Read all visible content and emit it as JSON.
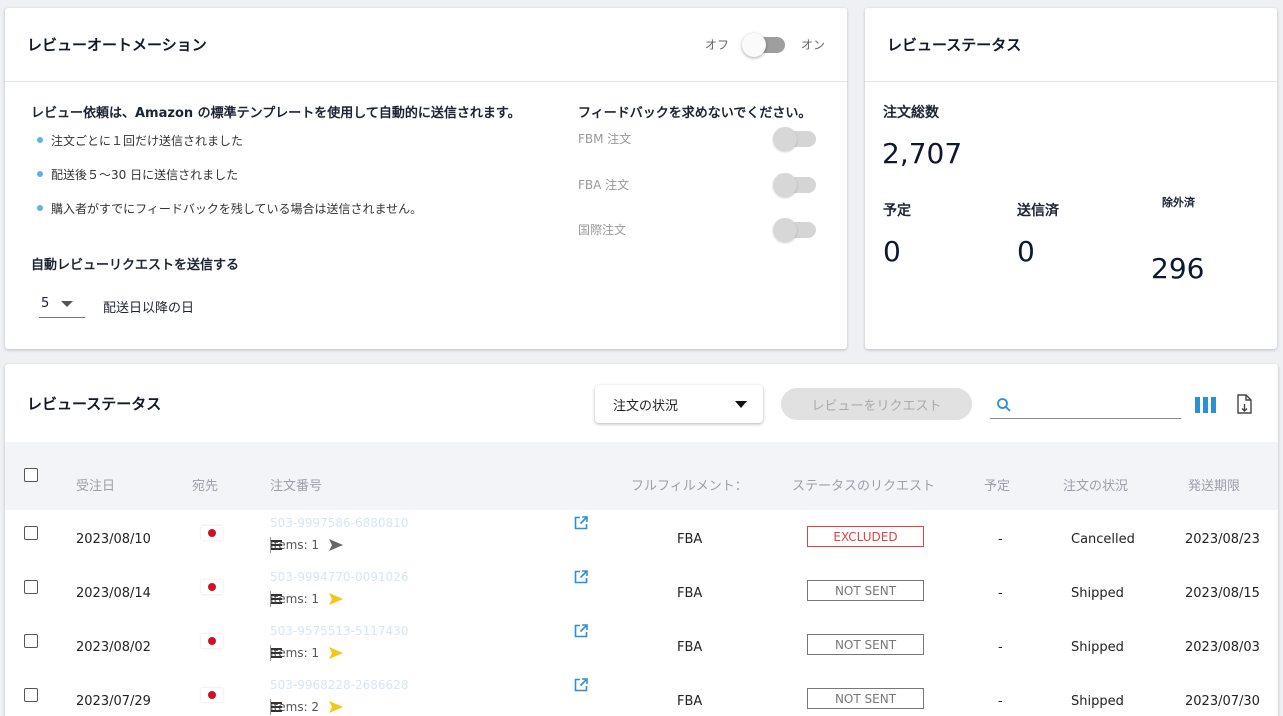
{
  "automation": {
    "title": "レビューオートメーション",
    "toggle_off": "オフ",
    "toggle_on": "オン",
    "request_desc": "レビュー依頼は、Amazon の標準テンプレートを使用して自動的に送信されます。",
    "bullets": [
      "注文ごとに１回だけ送信されました",
      "配送後５〜30 日に送信されました",
      "購入者がすでにフィードバックを残している場合は送信されません。"
    ],
    "send_title": "自動レビューリクエストを送信する",
    "days_value": "5",
    "days_suffix": "配送日以降の日",
    "feedback_title": "フィードバックを求めないでください。",
    "feedback_options": [
      "FBM 注文",
      "FBA 注文",
      "国際注文"
    ]
  },
  "status_card": {
    "title": "レビューステータス",
    "total_label": "注文総数",
    "total_value": "2,707",
    "scheduled_label": "予定",
    "scheduled_value": "0",
    "sent_label": "送信済",
    "sent_value": "0",
    "excluded_label": "除外済",
    "excluded_value": "296"
  },
  "table": {
    "title": "レビューステータス",
    "order_status_select": "注文の状況",
    "request_button": "レビューをリクエスト",
    "search_placeholder": "",
    "columns": [
      "受注日",
      "宛先",
      "注文番号",
      "フルフィルメント：",
      "ステータスのリクエスト",
      "予定",
      "注文の状況",
      "発送期限"
    ],
    "rows": [
      {
        "date": "2023/08/10",
        "order_no": "503-9997586-6880810",
        "items": "Items: 1",
        "fulfillment": "FBA",
        "request_status": "EXCLUDED",
        "scheduled": "-",
        "order_status": "Cancelled",
        "ship_by": "2023/08/23",
        "send_color": "#666666",
        "status_color": "#e04545"
      },
      {
        "date": "2023/08/14",
        "order_no": "503-9994770-0091026",
        "items": "Items: 1",
        "fulfillment": "FBA",
        "request_status": "NOT SENT",
        "scheduled": "-",
        "order_status": "Shipped",
        "ship_by": "2023/08/15",
        "send_color": "#f5c518",
        "status_color": "#777777"
      },
      {
        "date": "2023/08/02",
        "order_no": "503-9575513-5117430",
        "items": "Items: 1",
        "fulfillment": "FBA",
        "request_status": "NOT SENT",
        "scheduled": "-",
        "order_status": "Shipped",
        "ship_by": "2023/08/03",
        "send_color": "#f5c518",
        "status_color": "#777777"
      },
      {
        "date": "2023/07/29",
        "order_no": "503-9968228-2686628",
        "items": "Items: 2",
        "fulfillment": "FBA",
        "request_status": "NOT SENT",
        "scheduled": "-",
        "order_status": "Shipped",
        "ship_by": "2023/07/30",
        "send_color": "#f5c518",
        "status_color": "#777777"
      }
    ]
  },
  "icons": {
    "search": "search-icon",
    "columns": "columns-icon",
    "export": "export-icon",
    "external_link": "external-link-icon",
    "send": "send-icon",
    "note": "note-icon",
    "flag": "japan-flag-icon"
  },
  "colors": {
    "accent": "#2d8fd5",
    "excluded": "#e04545",
    "send_active": "#f5c518"
  }
}
